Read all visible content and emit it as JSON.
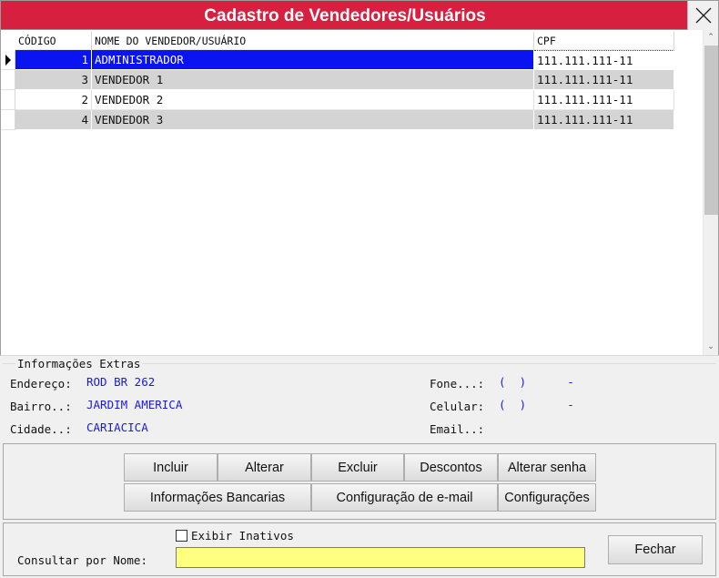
{
  "window": {
    "title": "Cadastro de Vendedores/Usuários",
    "close_icon": "close-x-icon",
    "title_bar_color": "#d7203f"
  },
  "grid": {
    "columns": [
      "CÓDIGO",
      "NOME DO VENDEDOR/USUÁRIO",
      "CPF"
    ],
    "rows": [
      {
        "code": "1",
        "name": "ADMINISTRADOR",
        "cpf": "111.111.111-11"
      },
      {
        "code": "3",
        "name": "VENDEDOR 1",
        "cpf": "111.111.111-11"
      },
      {
        "code": "2",
        "name": "VENDEDOR 2",
        "cpf": "111.111.111-11"
      },
      {
        "code": "4",
        "name": "VENDEDOR 3",
        "cpf": "111.111.111-11"
      }
    ],
    "selected_row_color": "#0a14f0"
  },
  "info": {
    "legend": "Informações Extras",
    "endereco_label": "Endereço:",
    "endereco_value": "ROD BR 262",
    "bairro_label": "Bairro..:",
    "bairro_value": "JARDIM AMERICA",
    "cidade_label": "Cidade..:",
    "cidade_value": "CARIACICA",
    "fone_label": "Fone...:",
    "fone_value": "(  )      -",
    "celular_label": "Celular:",
    "celular_value": "(  )      -",
    "email_label": "Email..:",
    "email_value": ""
  },
  "buttons": {
    "incluir": "Incluir",
    "alterar": "Alterar",
    "excluir": "Excluir",
    "descontos": "Descontos",
    "alterar_senha": "Alterar senha",
    "info_bancarias": "Informações Bancarias",
    "config_email": "Configuração de e-mail",
    "configuracoes": "Configurações",
    "fechar": "Fechar"
  },
  "bottom": {
    "exibir_inativos_label": "Exibir Inativos",
    "exibir_inativos_checked": false,
    "consultar_label": "Consultar por Nome:",
    "consultar_value": "",
    "input_color": "#ffff80"
  }
}
